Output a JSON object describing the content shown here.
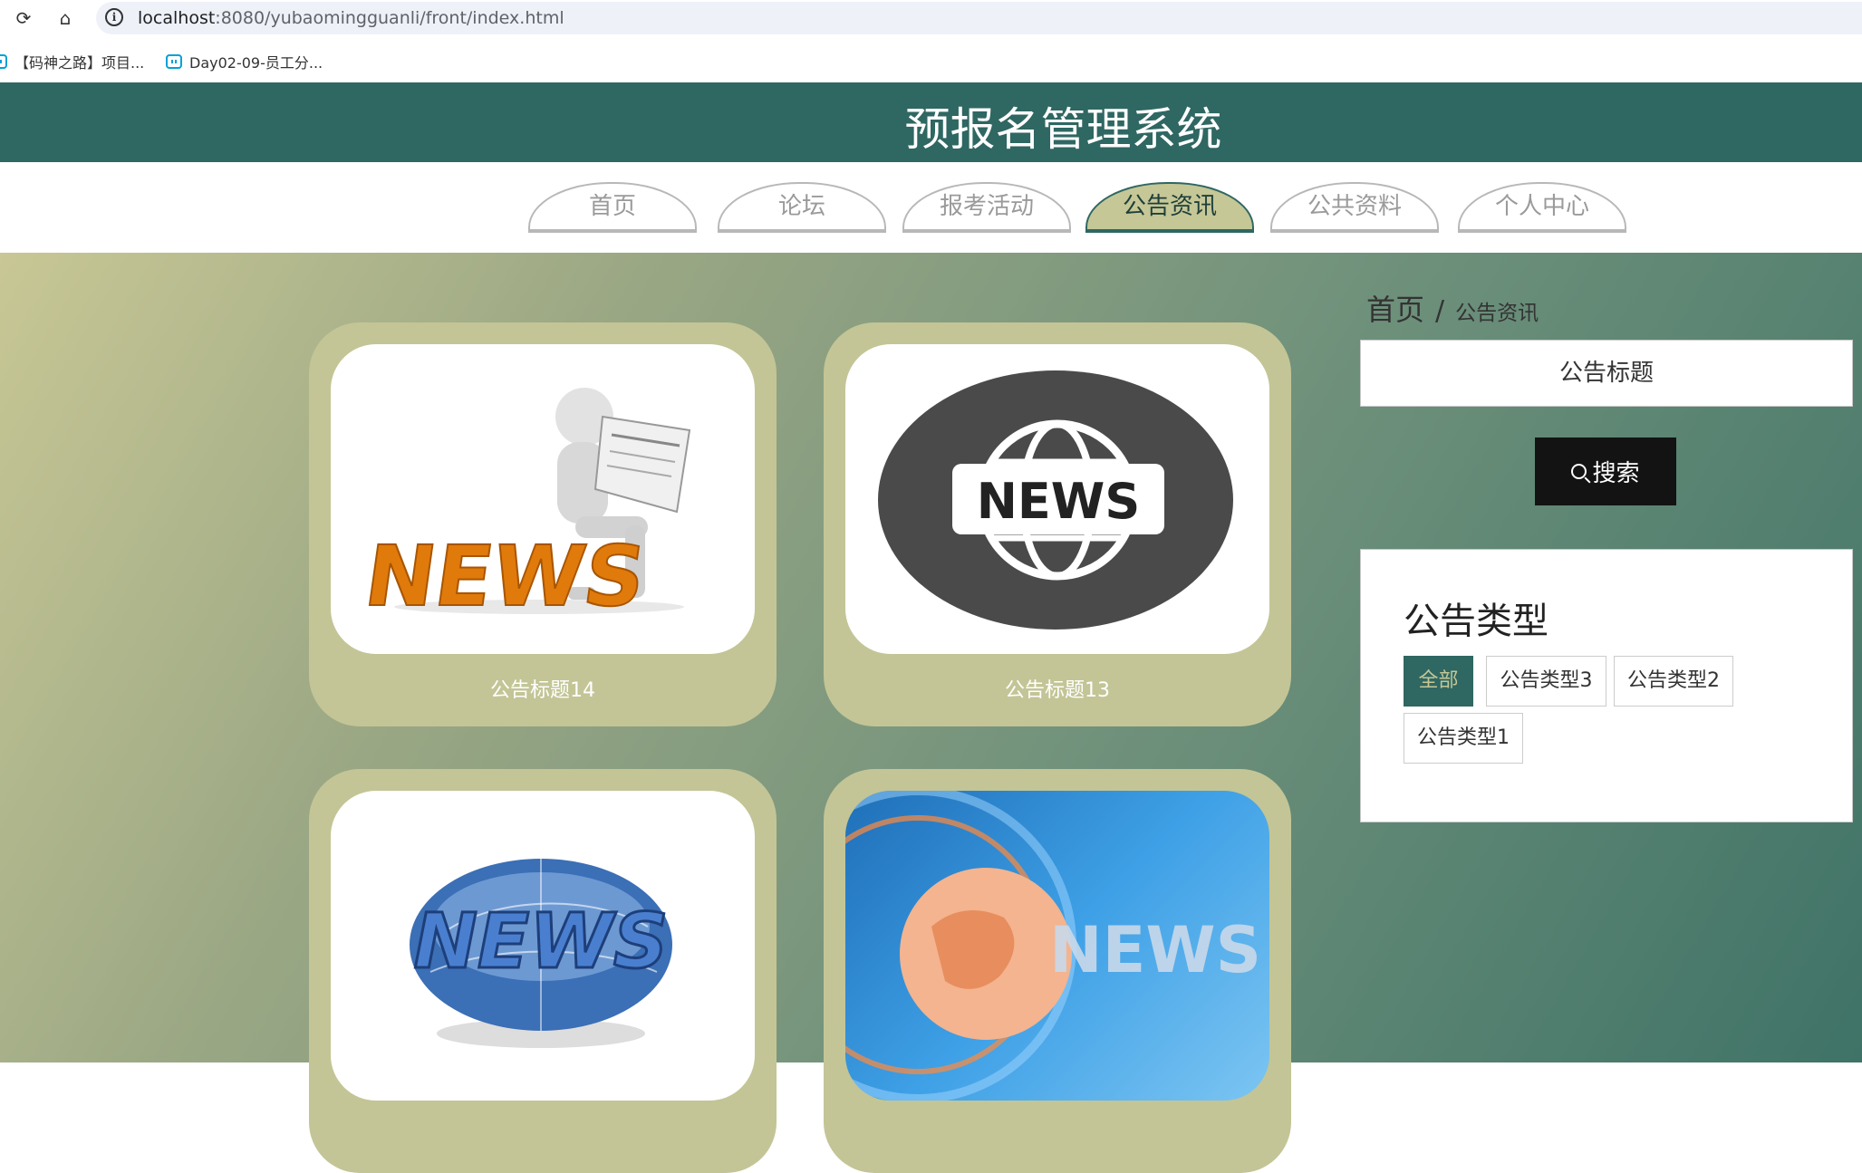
{
  "browser": {
    "url_host": "localhost",
    "url_rest": ":8080/yubaomingguanli/front/index.html",
    "bookmarks": [
      "【码神之路】项目...",
      "Day02-09-员工分..."
    ]
  },
  "site": {
    "title": "预报名管理系统",
    "nav": [
      "首页",
      "论坛",
      "报考活动",
      "公告资讯",
      "公共资料",
      "个人中心"
    ],
    "active_nav": "公告资讯"
  },
  "breadcrumb": {
    "home": "首页",
    "separator": "/",
    "current": "公告资讯"
  },
  "search": {
    "placeholder": "公告标题",
    "button_label": "搜索"
  },
  "types": {
    "title": "公告类型",
    "items": [
      "全部",
      "公告类型3",
      "公告类型2",
      "公告类型1"
    ],
    "active": "全部"
  },
  "cards": [
    {
      "title": "公告标题14",
      "image": "news-reader-image"
    },
    {
      "title": "公告标题13",
      "image": "news-globe-badge-image"
    },
    {
      "title": "",
      "image": "news-3d-globe-image"
    },
    {
      "title": "",
      "image": "news-broadcast-image"
    }
  ],
  "colors": {
    "header": "#2f6762",
    "card": "#c3c596",
    "active_tab": "#c5c796"
  }
}
